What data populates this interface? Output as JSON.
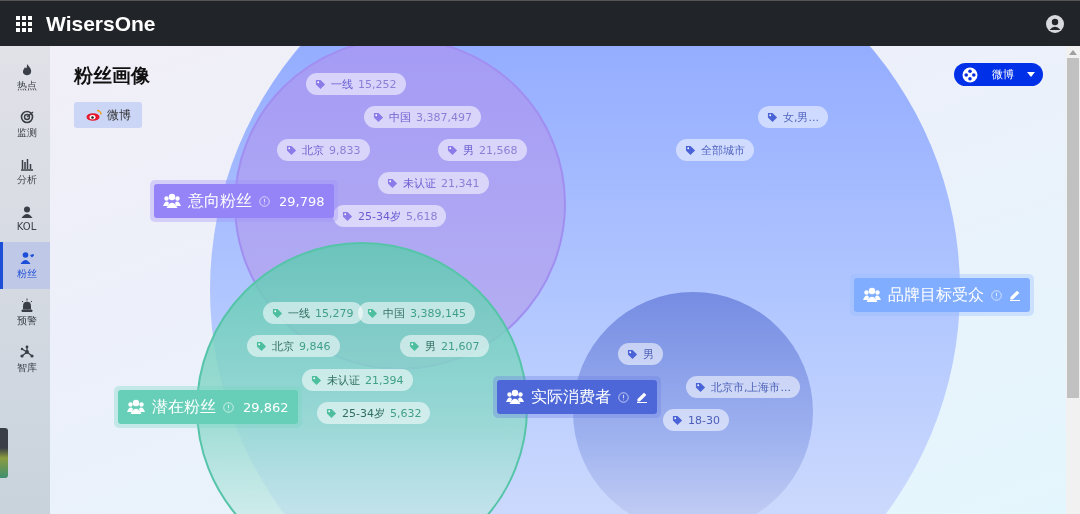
{
  "app": {
    "title": "WisersOne"
  },
  "sidebar": {
    "items": [
      {
        "kind": "flame",
        "label": "热点",
        "selected": false
      },
      {
        "kind": "radar",
        "label": "监测",
        "selected": false
      },
      {
        "kind": "chart",
        "label": "分析",
        "selected": false
      },
      {
        "kind": "person",
        "label": "KOL",
        "selected": false
      },
      {
        "kind": "fans",
        "label": "粉丝",
        "selected": true
      },
      {
        "kind": "alarm",
        "label": "预警",
        "selected": false
      },
      {
        "kind": "network",
        "label": "智库",
        "selected": false
      }
    ]
  },
  "page": {
    "title": "粉丝画像",
    "platform_chip": "微博",
    "platform_select": "微博"
  },
  "audiences": [
    {
      "kind": "intent",
      "name": "意向粉丝",
      "count": "29,798",
      "editable": false,
      "tags": [
        {
          "label": "一线",
          "count": "15,252"
        },
        {
          "label": "中国",
          "count": "3,387,497"
        },
        {
          "label": "北京",
          "count": "9,833"
        },
        {
          "label": "男",
          "count": "21,568"
        },
        {
          "label": "未认证",
          "count": "21,341"
        },
        {
          "label": "25-34岁",
          "count": "5,618"
        }
      ]
    },
    {
      "kind": "potential",
      "name": "潜在粉丝",
      "count": "29,862",
      "editable": false,
      "tags": [
        {
          "label": "一线",
          "count": "15,279"
        },
        {
          "label": "中国",
          "count": "3,389,145"
        },
        {
          "label": "北京",
          "count": "9,846"
        },
        {
          "label": "男",
          "count": "21,607"
        },
        {
          "label": "未认证",
          "count": "21,394"
        },
        {
          "label": "25-34岁",
          "count": "5,632"
        }
      ]
    },
    {
      "kind": "actual",
      "name": "实际消费者",
      "editable": true,
      "tags": [
        {
          "label": "男"
        },
        {
          "label": "北京市,上海市..."
        },
        {
          "label": "18-30"
        }
      ]
    },
    {
      "kind": "target",
      "name": "品牌目标受众",
      "editable": true,
      "tags": [
        {
          "label": "女,男..."
        },
        {
          "label": "全部城市"
        }
      ]
    }
  ]
}
